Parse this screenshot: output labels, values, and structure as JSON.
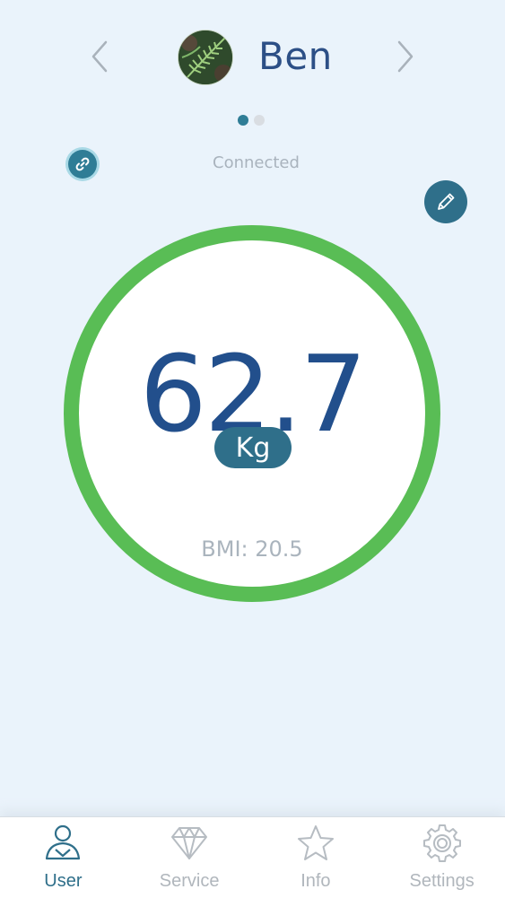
{
  "header": {
    "user_name": "Ben",
    "prev_icon": "chevron-left-icon",
    "next_icon": "chevron-right-icon",
    "avatar_icon": "fern-photo-avatar",
    "page_count": 2,
    "active_page": 1
  },
  "connection": {
    "status_text": "Connected",
    "link_icon": "link-icon",
    "edit_icon": "pencil-icon"
  },
  "measurement": {
    "weight": "62.7",
    "unit": "Kg",
    "bmi_text": "BMI: 20.5"
  },
  "tabs": [
    {
      "label": "User",
      "icon": "user-icon",
      "active": true
    },
    {
      "label": "Service",
      "icon": "diamond-icon",
      "active": false
    },
    {
      "label": "Info",
      "icon": "star-icon",
      "active": false
    },
    {
      "label": "Settings",
      "icon": "gear-icon",
      "active": false
    }
  ],
  "colors": {
    "background": "#eaf3fb",
    "primary_text": "#224f8c",
    "accent": "#2f6f8a",
    "gauge_ring": "#59bd55",
    "muted_text": "#aab4bd"
  }
}
